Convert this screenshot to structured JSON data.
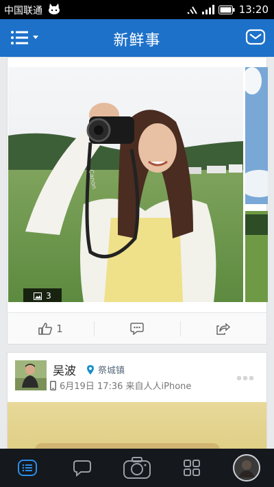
{
  "status": {
    "carrier": "中国联通",
    "time": "13:20"
  },
  "header": {
    "title": "新鲜事"
  },
  "post1": {
    "photo_count": "3",
    "like_count": "1"
  },
  "post2": {
    "user_name": "吴波",
    "location": "祭城镇",
    "meta": "6月19日 17:36 来自人人iPhone"
  },
  "colors": {
    "header_bg": "#1d71c9",
    "tab_bar_bg": "#15181d",
    "active_tab": "#2a8fe8"
  },
  "icons": [
    "menu-icon",
    "mail-icon",
    "like-icon",
    "comment-icon",
    "share-icon",
    "location-icon",
    "phone-icon",
    "feed-tab-icon",
    "chat-tab-icon",
    "camera-tab-icon",
    "apps-tab-icon",
    "profile-avatar"
  ]
}
